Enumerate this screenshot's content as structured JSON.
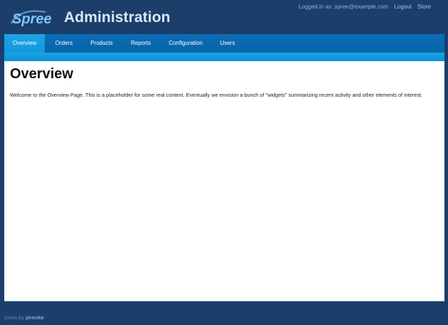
{
  "header": {
    "logo_text": "Spree",
    "app_title": "Administration",
    "logged_in_label": "Logged in as: spree@example.com",
    "logout_link": "Logout",
    "store_link": "Store"
  },
  "nav": {
    "tabs": [
      {
        "label": "Overview",
        "active": true
      },
      {
        "label": "Orders"
      },
      {
        "label": "Products"
      },
      {
        "label": "Reports"
      },
      {
        "label": "Configuration"
      },
      {
        "label": "Users"
      }
    ]
  },
  "main": {
    "title": "Overview",
    "body": "Welcome to the Overview Page. This is a placeholder for some real content. Eventually we envision a bunch of \"widgets\" summarizing recent activity and other elements of interest."
  },
  "footer": {
    "prefix": "Icons by",
    "link": "pinvoke"
  },
  "colors": {
    "background": "#1b3e6b",
    "nav": "#0b6eb6",
    "nav_active": "#1aa4e6"
  }
}
